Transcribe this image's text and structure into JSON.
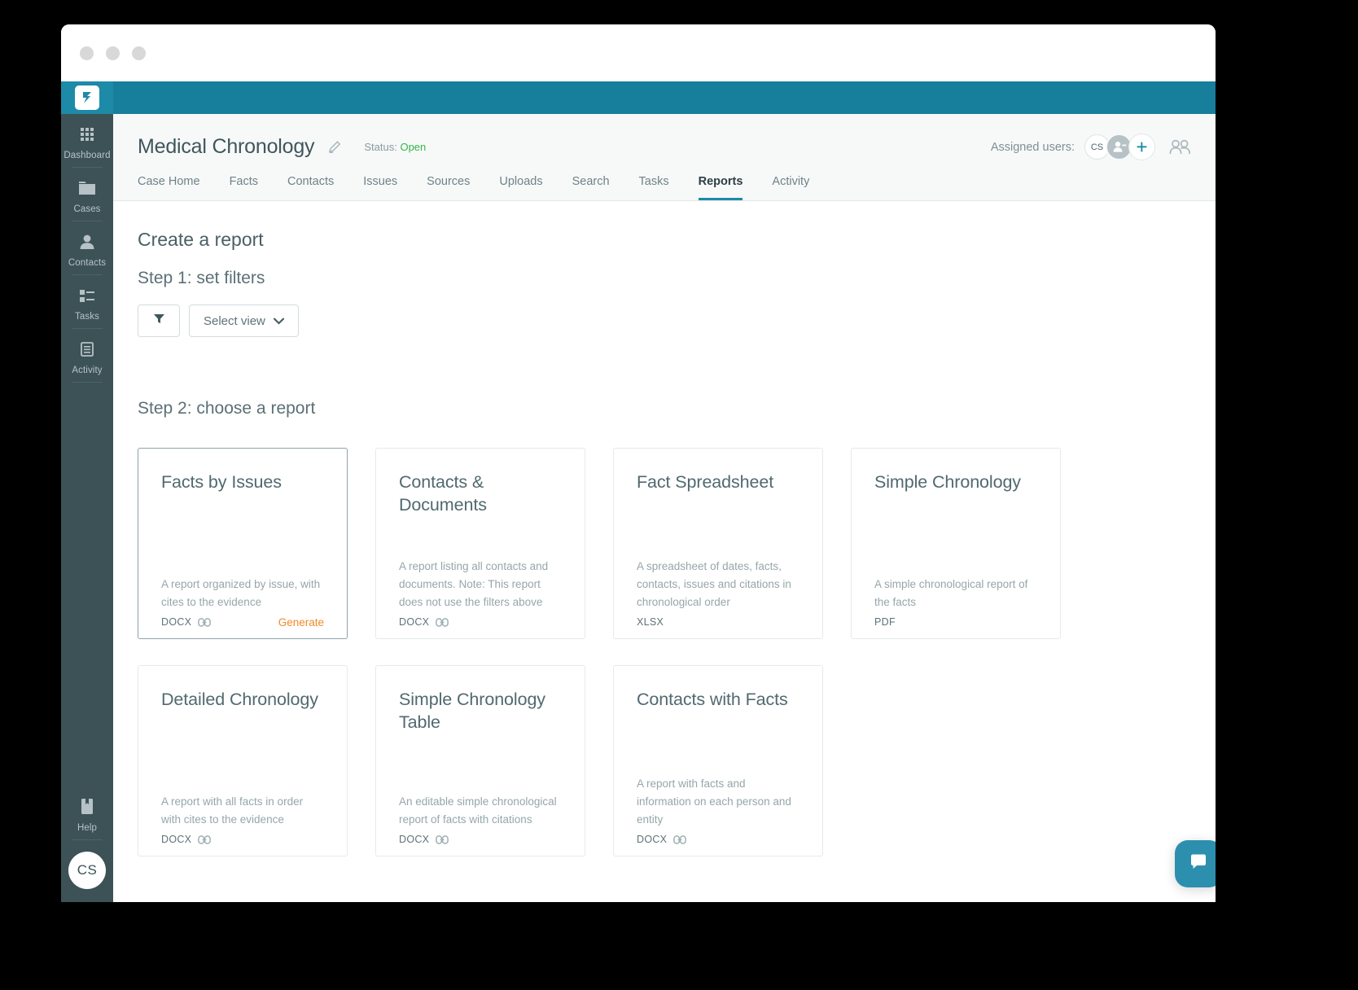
{
  "window": {
    "traffic_lights": [
      "close",
      "minimize",
      "maximize"
    ]
  },
  "app": {
    "logo_name": "lexbe-logo"
  },
  "rail": {
    "items": [
      {
        "label": "Dashboard",
        "icon": "grid-icon"
      },
      {
        "label": "Cases",
        "icon": "folder-icon"
      },
      {
        "label": "Contacts",
        "icon": "person-icon"
      },
      {
        "label": "Tasks",
        "icon": "task-list-icon"
      },
      {
        "label": "Activity",
        "icon": "document-lines-icon"
      }
    ],
    "help": {
      "label": "Help",
      "icon": "book-icon"
    },
    "avatar_initials": "CS"
  },
  "case_header": {
    "title": "Medical Chronology",
    "edit_icon": "pencil-icon",
    "status_label": "Status:",
    "status_value": "Open",
    "assigned_label": "Assigned users:",
    "assigned_avatar": "CS",
    "remove_user_icon": "person-minus-icon",
    "add_user_icon": "plus-icon",
    "group_icon": "people-icon"
  },
  "tabs": [
    {
      "label": "Case Home",
      "active": false
    },
    {
      "label": "Facts",
      "active": false
    },
    {
      "label": "Contacts",
      "active": false
    },
    {
      "label": "Issues",
      "active": false
    },
    {
      "label": "Sources",
      "active": false
    },
    {
      "label": "Uploads",
      "active": false
    },
    {
      "label": "Search",
      "active": false
    },
    {
      "label": "Tasks",
      "active": false
    },
    {
      "label": "Reports",
      "active": true
    },
    {
      "label": "Activity",
      "active": false
    }
  ],
  "content": {
    "page_title": "Create a report",
    "step1_title": "Step 1: set filters",
    "filter_icon": "funnel-icon",
    "select_view_label": "Select view",
    "select_chevron": "chevron-down-icon",
    "step2_title": "Step 2: choose a report"
  },
  "cards": [
    {
      "title": "Facts by Issues",
      "desc": "A report organized by issue, with cites to the evidence",
      "format": "DOCX",
      "has_link_icon": true,
      "generate_label": "Generate",
      "selected": true
    },
    {
      "title": "Contacts & Documents",
      "desc": "A report listing all contacts and documents. Note: This report does not use the filters above",
      "format": "DOCX",
      "has_link_icon": true,
      "generate_label": "",
      "selected": false
    },
    {
      "title": "Fact Spreadsheet",
      "desc": "A spreadsheet of dates, facts, contacts, issues and citations in chronological order",
      "format": "XLSX",
      "has_link_icon": false,
      "generate_label": "",
      "selected": false
    },
    {
      "title": "Simple Chronology",
      "desc": "A simple chronological report of the facts",
      "format": "PDF",
      "has_link_icon": false,
      "generate_label": "",
      "selected": false
    },
    {
      "title": "Detailed Chronology",
      "desc": "A report with all facts in order with cites to the evidence",
      "format": "DOCX",
      "has_link_icon": true,
      "generate_label": "",
      "selected": false
    },
    {
      "title": "Simple Chronology Table",
      "desc": "An editable simple chronological report of facts with citations",
      "format": "DOCX",
      "has_link_icon": true,
      "generate_label": "",
      "selected": false
    },
    {
      "title": "Contacts with Facts",
      "desc": "A report with facts and information on each person and entity",
      "format": "DOCX",
      "has_link_icon": true,
      "generate_label": "",
      "selected": false
    }
  ],
  "chat_widget": {
    "icon": "chat-bubble-icon"
  },
  "colors": {
    "teal": "#1d8aa8",
    "rail": "#3d5257",
    "orange": "#f08a29",
    "green": "#36b449"
  }
}
